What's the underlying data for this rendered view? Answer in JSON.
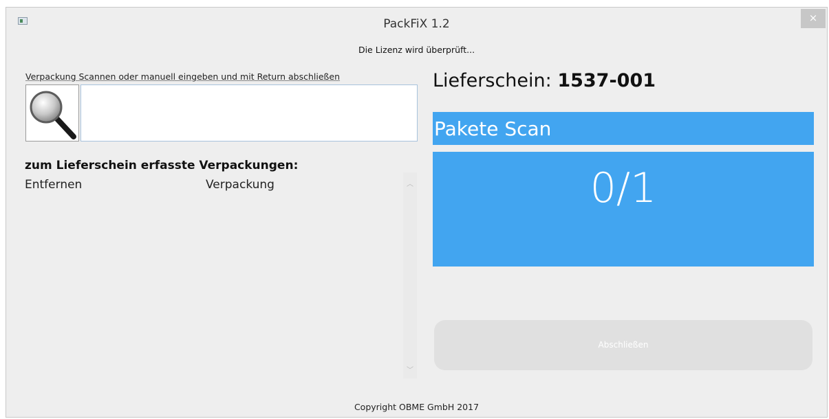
{
  "window": {
    "title": "PackFiX 1.2",
    "close_label": "×"
  },
  "status": {
    "license": "Die Lizenz wird überprüft..."
  },
  "scan": {
    "hint": "Verpackung Scannen oder manuell eingeben und mit Return abschließen",
    "input_value": ""
  },
  "list": {
    "heading": "zum Lieferschein erfasste Verpackungen:",
    "columns": [
      "Entfernen",
      "Verpackung"
    ],
    "rows": []
  },
  "delivery": {
    "label": "Lieferschein:",
    "number": "1537-001"
  },
  "packages": {
    "header": "Pakete Scan",
    "count": "0/1",
    "accent_color": "#42a5f0"
  },
  "actions": {
    "finish_label": "Abschließen",
    "finish_enabled": false
  },
  "footer": {
    "copyright": "Copyright OBME GmbH 2017"
  },
  "icons": {
    "app": "app-window-icon",
    "search": "magnifier-icon",
    "close": "close-icon",
    "scroll_up": "chevron-up-icon",
    "scroll_down": "chevron-down-icon"
  }
}
